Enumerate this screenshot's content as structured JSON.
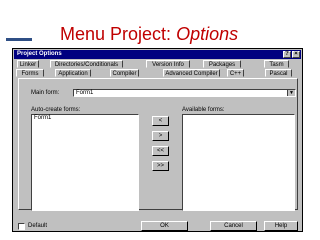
{
  "slide": {
    "title_prefix": "Menu Project: ",
    "title_emphasis": "Options"
  },
  "window": {
    "title": "Project Options",
    "help_button": "?",
    "close_button": "×"
  },
  "tabs_row1": [
    {
      "label": "Linker"
    },
    {
      "label": "Directories/Conditionals"
    },
    {
      "label": "Version Info"
    },
    {
      "label": "Packages"
    },
    {
      "label": "Tasm"
    }
  ],
  "tabs_row2": [
    {
      "label": "Forms"
    },
    {
      "label": "Application"
    },
    {
      "label": "Compiler"
    },
    {
      "label": "Advanced Compiler"
    },
    {
      "label": "C++"
    },
    {
      "label": "Pascal"
    }
  ],
  "forms_tab": {
    "main_form_label": "Main form:",
    "main_form_value": "Form1",
    "auto_create_label": "Auto-create forms:",
    "auto_create_items": [
      "Form1"
    ],
    "available_label": "Available forms:",
    "available_items": [],
    "move_buttons": [
      "<",
      ">",
      "<<",
      ">>"
    ]
  },
  "footer": {
    "default_label": "Default",
    "default_checked": false,
    "ok": "OK",
    "cancel": "Cancel",
    "help": "Help"
  }
}
